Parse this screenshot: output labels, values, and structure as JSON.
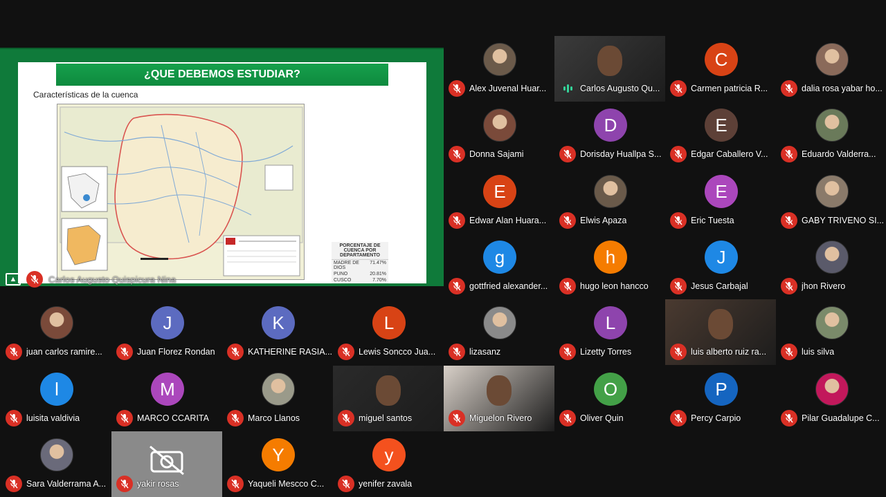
{
  "presentation": {
    "slide_title": "¿QUE DEBEMOS ESTUDIAR?",
    "slide_subtitle": "Características de la cuenca",
    "table_title": "PORCENTAJE DE CUENCA POR DEPARTAMENTO",
    "table_rows": [
      {
        "label": "MADRE DE DIOS",
        "value": "71.47%"
      },
      {
        "label": "PUNO",
        "value": "20.81%"
      },
      {
        "label": "CUSCO",
        "value": "7.70%"
      }
    ],
    "presenter_label": "Carlos Augusto Quispicura Nina"
  },
  "colors": {
    "mic_off": "#d93025",
    "slide_green": "#0f7a3a"
  },
  "participants": [
    {
      "name": "Alex Juvenal Huar...",
      "initial": "",
      "color": "#6b5a4a",
      "photo": true,
      "mic": "off"
    },
    {
      "name": "Carlos Augusto Qu...",
      "initial": "",
      "color": "#3b3b3b",
      "photo": true,
      "mic": "on",
      "video": true
    },
    {
      "name": "Carmen patricia R...",
      "initial": "C",
      "color": "#d84315",
      "photo": false,
      "mic": "off"
    },
    {
      "name": "dalia rosa yabar ho...",
      "initial": "",
      "color": "#8a6a5a",
      "photo": true,
      "mic": "off"
    },
    {
      "name": "Donna Sajami",
      "initial": "",
      "color": "#7a4a3a",
      "photo": true,
      "mic": "off"
    },
    {
      "name": "Dorisday Huallpa S...",
      "initial": "D",
      "color": "#8e44ad",
      "photo": false,
      "mic": "off"
    },
    {
      "name": "Edgar Caballero V...",
      "initial": "E",
      "color": "#5d4037",
      "photo": false,
      "mic": "off"
    },
    {
      "name": "Eduardo Valderra...",
      "initial": "",
      "color": "#6a7a5a",
      "photo": true,
      "mic": "off"
    },
    {
      "name": "Edwar Alan Huara...",
      "initial": "E",
      "color": "#d84315",
      "photo": false,
      "mic": "off"
    },
    {
      "name": "Elwis Apaza",
      "initial": "",
      "color": "#6a5a4a",
      "photo": true,
      "mic": "off"
    },
    {
      "name": "Eric Tuesta",
      "initial": "E",
      "color": "#ab47bc",
      "photo": false,
      "mic": "off"
    },
    {
      "name": "GABY TRIVENO SI...",
      "initial": "",
      "color": "#8a7a6a",
      "photo": true,
      "mic": "off"
    },
    {
      "name": "gottfried alexander...",
      "initial": "g",
      "color": "#1e88e5",
      "photo": false,
      "mic": "off"
    },
    {
      "name": "hugo leon hancco",
      "initial": "h",
      "color": "#f57c00",
      "photo": false,
      "mic": "off"
    },
    {
      "name": "Jesus Carbajal",
      "initial": "J",
      "color": "#1e88e5",
      "photo": false,
      "mic": "off"
    },
    {
      "name": "jhon Rivero",
      "initial": "",
      "color": "#5a5a6a",
      "photo": true,
      "mic": "off"
    },
    {
      "name": "juan carlos ramire...",
      "initial": "",
      "color": "#7a4a3a",
      "photo": true,
      "mic": "off"
    },
    {
      "name": "Juan Florez Rondan",
      "initial": "J",
      "color": "#5c6bc0",
      "photo": false,
      "mic": "off"
    },
    {
      "name": "KATHERINE RASIA...",
      "initial": "K",
      "color": "#5c6bc0",
      "photo": false,
      "mic": "off"
    },
    {
      "name": "Lewis Soncco Jua...",
      "initial": "L",
      "color": "#d84315",
      "photo": false,
      "mic": "off"
    },
    {
      "name": "lizasanz",
      "initial": "",
      "color": "#8a8a8a",
      "photo": true,
      "mic": "off"
    },
    {
      "name": "Lizetty Torres",
      "initial": "L",
      "color": "#8e44ad",
      "photo": false,
      "mic": "off"
    },
    {
      "name": "luis alberto ruiz ra...",
      "initial": "",
      "color": "#4a3a30",
      "photo": true,
      "mic": "off",
      "video": true
    },
    {
      "name": "luis silva",
      "initial": "",
      "color": "#7a8a6a",
      "photo": true,
      "mic": "off"
    },
    {
      "name": "luisita valdivia",
      "initial": "l",
      "color": "#1e88e5",
      "photo": false,
      "mic": "off"
    },
    {
      "name": "MARCO CCARITA",
      "initial": "M",
      "color": "#ab47bc",
      "photo": false,
      "mic": "off"
    },
    {
      "name": "Marco Llanos",
      "initial": "",
      "color": "#9a9a8a",
      "photo": true,
      "mic": "off"
    },
    {
      "name": "miguel santos",
      "initial": "",
      "color": "#2a2a2a",
      "photo": true,
      "mic": "off",
      "video": true
    },
    {
      "name": "Miguelon Rivero",
      "initial": "",
      "color": "#d8d0c8",
      "photo": true,
      "mic": "off",
      "video": true
    },
    {
      "name": "Oliver Quin",
      "initial": "O",
      "color": "#43a047",
      "photo": false,
      "mic": "off"
    },
    {
      "name": "Percy Carpio",
      "initial": "P",
      "color": "#1565c0",
      "photo": false,
      "mic": "off"
    },
    {
      "name": "Pilar Guadalupe C...",
      "initial": "",
      "color": "#c2185b",
      "photo": true,
      "mic": "off"
    },
    {
      "name": "Sara Valderrama A...",
      "initial": "",
      "color": "#6a6a7a",
      "photo": true,
      "mic": "off"
    },
    {
      "name": "yakir rosas",
      "initial": "",
      "color": "#8a8a8a",
      "photo": false,
      "mic": "off",
      "camera_off": true
    },
    {
      "name": "Yaqueli Mescco C...",
      "initial": "Y",
      "color": "#f57c00",
      "photo": false,
      "mic": "off"
    },
    {
      "name": "yenifer zavala",
      "initial": "y",
      "color": "#f4511e",
      "photo": false,
      "mic": "off"
    }
  ]
}
